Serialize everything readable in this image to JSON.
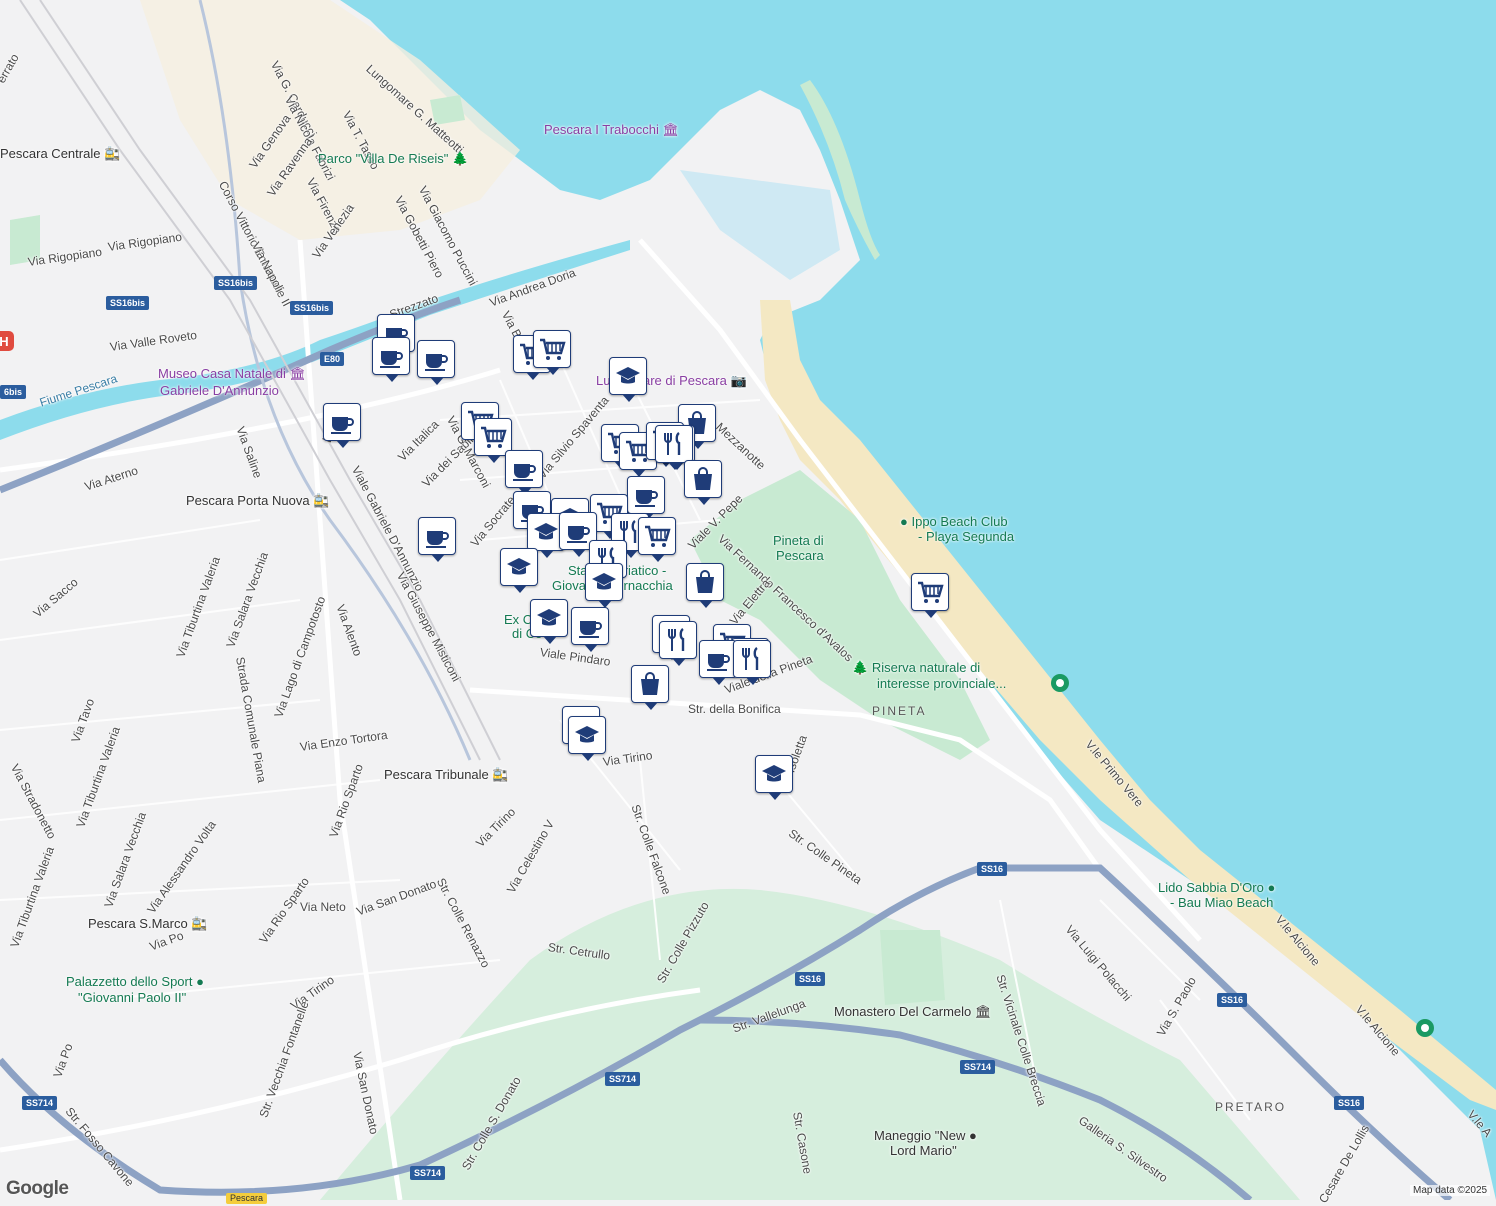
{
  "attribution": {
    "google": "Google",
    "map_data": "Map data ©2025"
  },
  "colors": {
    "sea": "#8ddcec",
    "land": "#f2f2f3",
    "park": "#c8ead2",
    "beach": "#f4e8c3",
    "highway": "#8da2c4",
    "marker_border": "#1f3c78",
    "poi_green": "#147a52",
    "poi_purple": "#8a3fa3"
  },
  "streets": [
    {
      "text": "Via G. Carducci"
    },
    {
      "text": "Via Nicola Fabrizi"
    },
    {
      "text": "Via T. Tasso"
    },
    {
      "text": "Lungomare G. Matteotti"
    },
    {
      "text": "Via Genova"
    },
    {
      "text": "Via Ravenna"
    },
    {
      "text": "Corso Vittorio Emanuele II"
    },
    {
      "text": "Via Firenze"
    },
    {
      "text": "Via Venezia"
    },
    {
      "text": "Via Giacomo Puccini"
    },
    {
      "text": "Via Gobetti Piero"
    },
    {
      "text": "Via Napoli"
    },
    {
      "text": "Via Rigopiano"
    },
    {
      "text": "Via Rigopiano"
    },
    {
      "text": "Via Valle Roveto"
    },
    {
      "text": "Fiume Pescara"
    },
    {
      "text": "Via Andrea Doria"
    },
    {
      "text": "Strezzato"
    },
    {
      "text": "Via Ruvo"
    },
    {
      "text": "Via Italica"
    },
    {
      "text": "Via dei Sabini"
    },
    {
      "text": "Via G. Marconi"
    },
    {
      "text": "Via Silvio Spaventa"
    },
    {
      "text": "Via Socrate"
    },
    {
      "text": "Via Saline"
    },
    {
      "text": "Via Aterno"
    },
    {
      "text": "Viale Gabriele D'Annunzio"
    },
    {
      "text": "Via Giuseppe Misticoni"
    },
    {
      "text": "Viale V. Pepe"
    },
    {
      "text": "Via Fernando Francesco d'Avalos"
    },
    {
      "text": "Via Elettra"
    },
    {
      "text": "Mezzanotte"
    },
    {
      "text": "Viale Pindaro"
    },
    {
      "text": "Viale della Pineta"
    },
    {
      "text": "Str. della Bonifica"
    },
    {
      "text": "Via Tirino"
    },
    {
      "text": "Via Sacco"
    },
    {
      "text": "Via Tiburtina Valeria"
    },
    {
      "text": "Via Salara Vecchia"
    },
    {
      "text": "Strada Comunale Piana"
    },
    {
      "text": "Via Lago di Campotosto"
    },
    {
      "text": "Via Alento"
    },
    {
      "text": "Via Tavo"
    },
    {
      "text": "Via Enzo Tortora"
    },
    {
      "text": "Via Stradonetto"
    },
    {
      "text": "Via Tiburtina Valeria"
    },
    {
      "text": "Via Rio Sparto"
    },
    {
      "text": "Via Tirino"
    },
    {
      "text": "Via Celestino V"
    },
    {
      "text": "Str. Colle Falcone"
    },
    {
      "text": "Str. Colle Renazzo"
    },
    {
      "text": "Via Salara Vecchia"
    },
    {
      "text": "Via Alessandro Volta"
    },
    {
      "text": "Via Tiburtina Valeria"
    },
    {
      "text": "Via Rio Sparto"
    },
    {
      "text": "Via Neto"
    },
    {
      "text": "Via San Donato"
    },
    {
      "text": "Via Po"
    },
    {
      "text": "Str. Cetrullo"
    },
    {
      "text": "Str. Colle Pizzuto"
    },
    {
      "text": "Via Tirino"
    },
    {
      "text": "Str. Vecchia Fontanelle"
    },
    {
      "text": "Via San Donato"
    },
    {
      "text": "Via Po"
    },
    {
      "text": "Str. Fosso Cavone"
    },
    {
      "text": "Str. Colle S. Donato"
    },
    {
      "text": "Str. Vallelunga"
    },
    {
      "text": "Str. Colle Pineta"
    },
    {
      "text": "Isoletta"
    },
    {
      "text": "V.le Primo Vere"
    },
    {
      "text": "Via Luigi Polacchi"
    },
    {
      "text": "Str. Vicinale Colle Breccia"
    },
    {
      "text": "Via S. Paolo"
    },
    {
      "text": "V.le Alcione"
    },
    {
      "text": "V.le Alcione"
    },
    {
      "text": "Str. Casone"
    },
    {
      "text": "Galleria S. Silvestro"
    },
    {
      "text": "Cesare De Lollis"
    },
    {
      "text": "V.le A"
    },
    {
      "text": "errato"
    },
    {
      "text": "Via Ba"
    }
  ],
  "areas": [
    {
      "text": "PINETA"
    },
    {
      "text": "PRETARO"
    }
  ],
  "shields": [
    {
      "text": "SS16bis"
    },
    {
      "text": "SS16bis"
    },
    {
      "text": "SS16bis"
    },
    {
      "text": "E80"
    },
    {
      "text": "SS16"
    },
    {
      "text": "SS16"
    },
    {
      "text": "SS16"
    },
    {
      "text": "SS16"
    },
    {
      "text": "SS714"
    },
    {
      "text": "SS714"
    },
    {
      "text": "SS714"
    },
    {
      "text": "SS714"
    },
    {
      "text": "6bis"
    }
  ],
  "yellow_shield": {
    "text": "Pescara"
  },
  "pois": [
    {
      "text": "Pescara I Trabocchi",
      "style": "purple",
      "icon": "museum-icon"
    },
    {
      "text": "Parco \"Villa De Riseis\"",
      "style": "green",
      "icon": "tree-icon"
    },
    {
      "text": "Pescara Centrale",
      "style": "dark",
      "icon": "train-icon"
    },
    {
      "text": "Museo Casa Natale di",
      "style": "purple",
      "icon": "museum-icon"
    },
    {
      "text": "Gabriele D'Annunzio",
      "style": "purple",
      "icon": ""
    },
    {
      "text": "Lungomare di Pescara",
      "style": "purple",
      "icon": "camera-icon"
    },
    {
      "text": "Pescara Porta Nuova",
      "style": "dark",
      "icon": "train-icon"
    },
    {
      "text": "Ippo Beach Club",
      "style": "green",
      "icon": "pin-icon"
    },
    {
      "text": "- Playa Segunda",
      "style": "green",
      "icon": ""
    },
    {
      "text": "Pineta di",
      "style": "green",
      "icon": ""
    },
    {
      "text": "Pescara",
      "style": "green",
      "icon": ""
    },
    {
      "text": "Stadio Adriatico -",
      "style": "green",
      "icon": ""
    },
    {
      "text": "Giovanni Cornacchia",
      "style": "green",
      "icon": ""
    },
    {
      "text": "Ex C",
      "style": "green",
      "icon": ""
    },
    {
      "text": "di Co",
      "style": "green",
      "icon": ""
    },
    {
      "text": "Riserva naturale di",
      "style": "green",
      "icon": "tree-icon"
    },
    {
      "text": "interesse provinciale...",
      "style": "green",
      "icon": ""
    },
    {
      "text": "Pescara Tribunale",
      "style": "dark",
      "icon": "train-icon"
    },
    {
      "text": "Pescara S.Marco",
      "style": "dark",
      "icon": "train-icon"
    },
    {
      "text": "Palazzetto dello Sport",
      "style": "green",
      "icon": "pin-icon"
    },
    {
      "text": "\"Giovanni Paolo II\"",
      "style": "green",
      "icon": ""
    },
    {
      "text": "Lido Sabbia D'Oro",
      "style": "green",
      "icon": "pin-icon"
    },
    {
      "text": "- Bau Miao Beach",
      "style": "green",
      "icon": ""
    },
    {
      "text": "Monastero Del Carmelo",
      "style": "dark",
      "icon": "museum-icon"
    },
    {
      "text": "Maneggio \"New",
      "style": "dark",
      "icon": "pin-icon"
    },
    {
      "text": "Lord Mario\"",
      "style": "dark",
      "icon": ""
    }
  ],
  "markers": [
    {
      "icon": "coffee"
    },
    {
      "icon": "coffee"
    },
    {
      "icon": "coffee"
    },
    {
      "icon": "cart"
    },
    {
      "icon": "cart"
    },
    {
      "icon": "cart"
    },
    {
      "icon": "school"
    },
    {
      "icon": "coffee"
    },
    {
      "icon": "cart"
    },
    {
      "icon": "cart"
    },
    {
      "icon": "bag"
    },
    {
      "icon": "cart"
    },
    {
      "icon": "cart"
    },
    {
      "icon": "cart"
    },
    {
      "icon": "fork"
    },
    {
      "icon": "coffee"
    },
    {
      "icon": "bag"
    },
    {
      "icon": "coffee"
    },
    {
      "icon": "coffee"
    },
    {
      "icon": "school"
    },
    {
      "icon": "cart"
    },
    {
      "icon": "school"
    },
    {
      "icon": "coffee"
    },
    {
      "icon": "fork"
    },
    {
      "icon": "cart"
    },
    {
      "icon": "coffee"
    },
    {
      "icon": "school"
    },
    {
      "icon": "fork"
    },
    {
      "icon": "school"
    },
    {
      "icon": "bag"
    },
    {
      "icon": "school"
    },
    {
      "icon": "coffee"
    },
    {
      "icon": "fork"
    },
    {
      "icon": "fork"
    },
    {
      "icon": "cart"
    },
    {
      "icon": "fork"
    },
    {
      "icon": "coffee"
    },
    {
      "icon": "fork"
    },
    {
      "icon": "bag"
    },
    {
      "icon": "school"
    },
    {
      "icon": "school"
    },
    {
      "icon": "school"
    },
    {
      "icon": "cart"
    }
  ]
}
